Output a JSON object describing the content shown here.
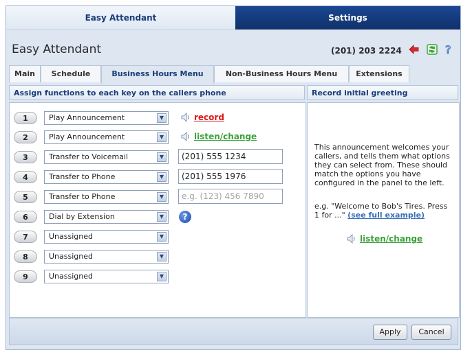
{
  "top_tabs": {
    "easy": "Easy Attendant",
    "settings": "Settings"
  },
  "header": {
    "title": "Easy Attendant",
    "phone": "(201) 203 2224"
  },
  "sub_tabs": [
    "Main",
    "Schedule",
    "Business Hours Menu",
    "Non-Business Hours Menu",
    "Extensions"
  ],
  "left_panel": {
    "title": "Assign functions to each key on the callers phone"
  },
  "right_panel": {
    "title": "Record initial greeting",
    "description": "This announcement welcomes your callers, and tells them what options they can select from. These should match the options you have configured in the panel to the left.",
    "example_text": "e.g. \"Welcome to Bob's Tires. Press 1 for ...\"",
    "example_link": "(see full example)",
    "listen_link": "listen/change"
  },
  "keys": [
    {
      "num": "1",
      "option": "Play Announcement",
      "action": "record"
    },
    {
      "num": "2",
      "option": "Play Announcement",
      "action": "listen/change"
    },
    {
      "num": "3",
      "option": "Transfer to Voicemail",
      "value": "(201) 555 1234"
    },
    {
      "num": "4",
      "option": "Transfer to Phone",
      "value": "(201) 555 1976"
    },
    {
      "num": "5",
      "option": "Transfer to Phone",
      "placeholder": "e.g. (123) 456 7890"
    },
    {
      "num": "6",
      "option": "Dial by Extension"
    },
    {
      "num": "7",
      "option": "Unassigned"
    },
    {
      "num": "8",
      "option": "Unassigned"
    },
    {
      "num": "9",
      "option": "Unassigned"
    }
  ],
  "buttons": {
    "apply": "Apply",
    "cancel": "Cancel"
  },
  "colors": {
    "settings_tab": "#10306a",
    "record_link": "#e01616",
    "listen_link": "#3aa23a",
    "heading": "#1a3c78"
  }
}
